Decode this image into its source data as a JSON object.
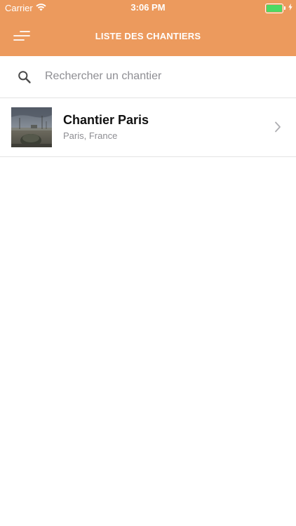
{
  "status_bar": {
    "carrier": "Carrier",
    "time": "3:06 PM",
    "battery_color": "#4CD964"
  },
  "nav": {
    "title": "LISTE DES CHANTIERS",
    "menu_icon": "menu-icon",
    "background_color": "#EC9A5D"
  },
  "search": {
    "placeholder": "Rechercher un chantier",
    "value": "",
    "icon": "search-icon"
  },
  "chantiers": [
    {
      "title": "Chantier Paris",
      "subtitle": "Paris, France",
      "thumbnail": "construction-site-photo",
      "trailing_icon": "chevron-right-icon"
    }
  ]
}
